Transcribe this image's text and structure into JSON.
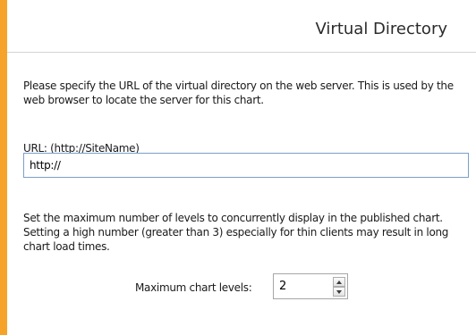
{
  "window": {
    "frame_color": "#f6a32c"
  },
  "header": {
    "title": "Virtual Directory"
  },
  "intro": {
    "text": "Please specify the URL of the virtual directory on the web server. This is used by the web browser to locate the server for this chart."
  },
  "url": {
    "label": "URL: (http://SiteName)",
    "value": "http://"
  },
  "levels": {
    "description": "Set the maximum number of levels to concurrently display in the published chart.  Setting a high number (greater than 3) especially for thin clients may result in long chart load times.",
    "label": "Maximum chart levels:",
    "value": "2"
  },
  "icons": {
    "spin_up": "chevron-up-icon",
    "spin_down": "chevron-down-icon"
  }
}
